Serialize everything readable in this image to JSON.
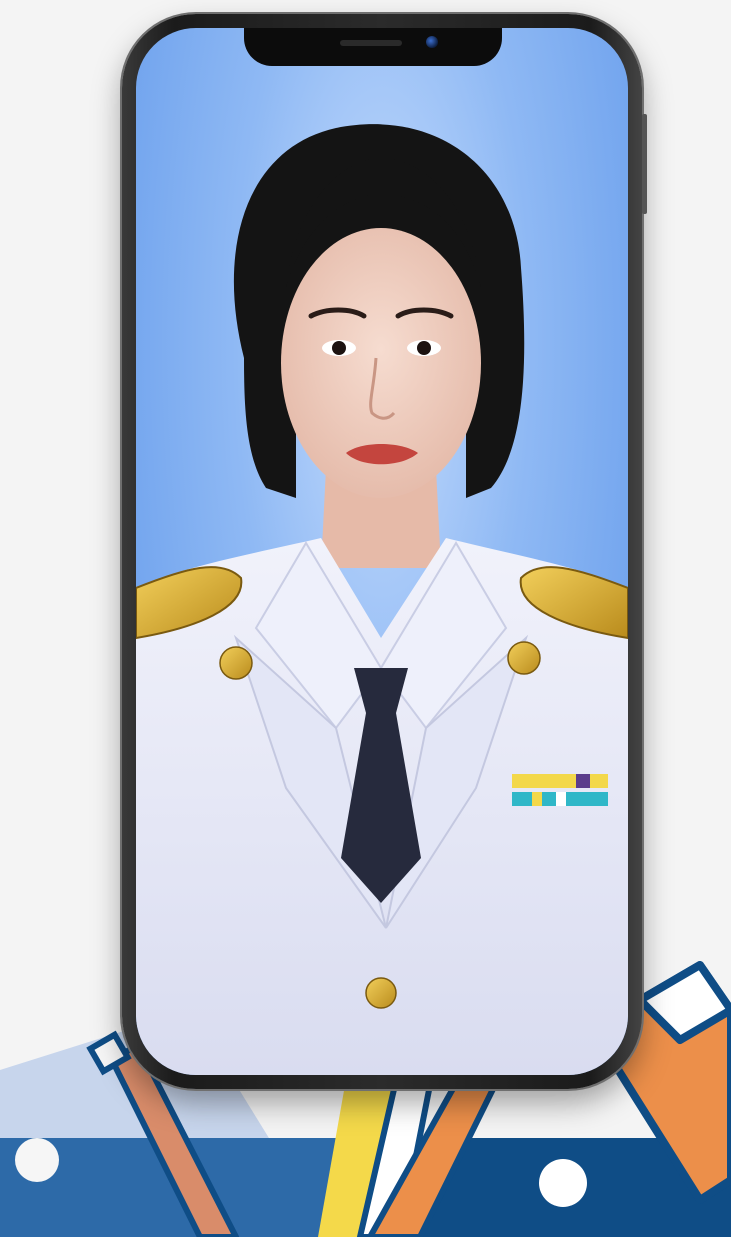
{
  "scene": {
    "background_color": "#f4f4f4",
    "photo_background_color": "#8fb9f4",
    "phone_frame_color": "#1f1f1f",
    "decorations": {
      "band_color": "#0f4d86",
      "band_light_color": "#2d6aa8",
      "pencil_color": "#d98c6a",
      "yellow_color": "#f4d94a",
      "orange_color": "#ec8f4a"
    }
  },
  "photo": {
    "subject": "portrait-photo",
    "uniform_color": "#e9ebf8",
    "tie_color": "#262a3d",
    "hair_color": "#141414",
    "epaulette_color": "#d8a92a"
  }
}
